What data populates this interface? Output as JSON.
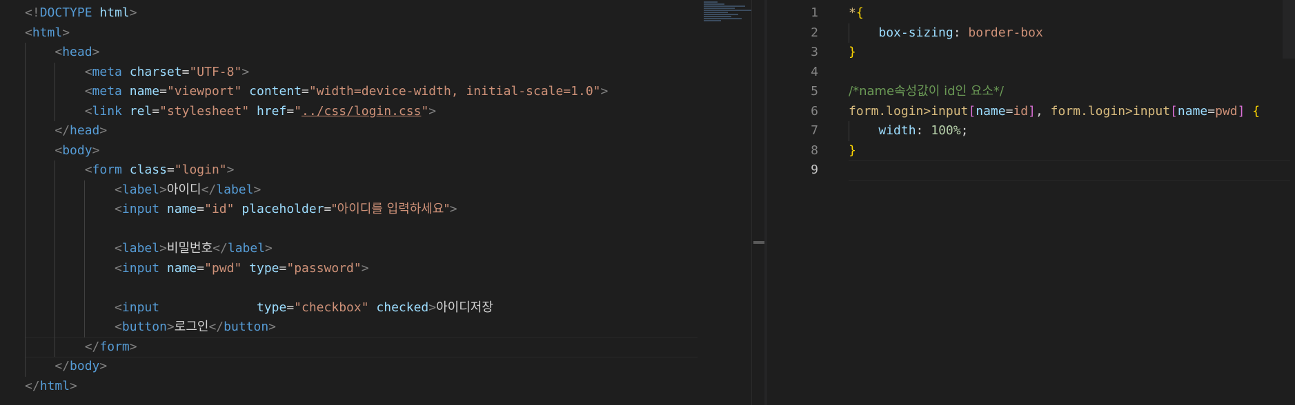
{
  "left_editor": {
    "lines": [
      [
        {
          "c": "t-br",
          "t": "<!"
        },
        {
          "c": "t-dt",
          "t": "DOCTYPE"
        },
        {
          "c": "t-txt",
          "t": " "
        },
        {
          "c": "t-attr",
          "t": "html"
        },
        {
          "c": "t-br",
          "t": ">"
        }
      ],
      [
        {
          "c": "t-br",
          "t": "<"
        },
        {
          "c": "t-tag",
          "t": "html"
        },
        {
          "c": "t-br",
          "t": ">"
        }
      ],
      [
        {
          "c": "t-txt",
          "t": "    "
        },
        {
          "c": "t-br",
          "t": "<"
        },
        {
          "c": "t-tag",
          "t": "head"
        },
        {
          "c": "t-br",
          "t": ">"
        }
      ],
      [
        {
          "c": "t-txt",
          "t": "        "
        },
        {
          "c": "t-br",
          "t": "<"
        },
        {
          "c": "t-tag",
          "t": "meta"
        },
        {
          "c": "t-txt",
          "t": " "
        },
        {
          "c": "t-attr",
          "t": "charset"
        },
        {
          "c": "t-txt",
          "t": "="
        },
        {
          "c": "t-str",
          "t": "\"UTF-8\""
        },
        {
          "c": "t-br",
          "t": ">"
        }
      ],
      [
        {
          "c": "t-txt",
          "t": "        "
        },
        {
          "c": "t-br",
          "t": "<"
        },
        {
          "c": "t-tag",
          "t": "meta"
        },
        {
          "c": "t-txt",
          "t": " "
        },
        {
          "c": "t-attr",
          "t": "name"
        },
        {
          "c": "t-txt",
          "t": "="
        },
        {
          "c": "t-str",
          "t": "\"viewport\""
        },
        {
          "c": "t-txt",
          "t": " "
        },
        {
          "c": "t-attr",
          "t": "content"
        },
        {
          "c": "t-txt",
          "t": "="
        },
        {
          "c": "t-str",
          "t": "\"width=device-width, initial-scale=1.0\""
        },
        {
          "c": "t-br",
          "t": ">"
        }
      ],
      [
        {
          "c": "t-txt",
          "t": "        "
        },
        {
          "c": "t-br",
          "t": "<"
        },
        {
          "c": "t-tag",
          "t": "link"
        },
        {
          "c": "t-txt",
          "t": " "
        },
        {
          "c": "t-attr",
          "t": "rel"
        },
        {
          "c": "t-txt",
          "t": "="
        },
        {
          "c": "t-str",
          "t": "\"stylesheet\""
        },
        {
          "c": "t-txt",
          "t": " "
        },
        {
          "c": "t-attr",
          "t": "href"
        },
        {
          "c": "t-txt",
          "t": "="
        },
        {
          "c": "t-str",
          "t": "\""
        },
        {
          "c": "t-str link",
          "t": "../css/login.css"
        },
        {
          "c": "t-str",
          "t": "\""
        },
        {
          "c": "t-br",
          "t": ">"
        }
      ],
      [
        {
          "c": "t-txt",
          "t": "    "
        },
        {
          "c": "t-br",
          "t": "</"
        },
        {
          "c": "t-tag",
          "t": "head"
        },
        {
          "c": "t-br",
          "t": ">"
        }
      ],
      [
        {
          "c": "t-txt",
          "t": "    "
        },
        {
          "c": "t-br",
          "t": "<"
        },
        {
          "c": "t-tag",
          "t": "body"
        },
        {
          "c": "t-br",
          "t": ">"
        }
      ],
      [
        {
          "c": "t-txt",
          "t": "        "
        },
        {
          "c": "t-br",
          "t": "<"
        },
        {
          "c": "t-tag",
          "t": "form"
        },
        {
          "c": "t-txt",
          "t": " "
        },
        {
          "c": "t-attr",
          "t": "class"
        },
        {
          "c": "t-txt",
          "t": "="
        },
        {
          "c": "t-str",
          "t": "\"login\""
        },
        {
          "c": "t-br",
          "t": ">"
        }
      ],
      [
        {
          "c": "t-txt",
          "t": "            "
        },
        {
          "c": "t-br",
          "t": "<"
        },
        {
          "c": "t-tag",
          "t": "label"
        },
        {
          "c": "t-br",
          "t": ">"
        },
        {
          "c": "t-txt ko",
          "t": "아이디"
        },
        {
          "c": "t-br",
          "t": "</"
        },
        {
          "c": "t-tag",
          "t": "label"
        },
        {
          "c": "t-br",
          "t": ">"
        }
      ],
      [
        {
          "c": "t-txt",
          "t": "            "
        },
        {
          "c": "t-br",
          "t": "<"
        },
        {
          "c": "t-tag",
          "t": "input"
        },
        {
          "c": "t-txt",
          "t": " "
        },
        {
          "c": "t-attr",
          "t": "name"
        },
        {
          "c": "t-txt",
          "t": "="
        },
        {
          "c": "t-str",
          "t": "\"id\""
        },
        {
          "c": "t-txt",
          "t": " "
        },
        {
          "c": "t-attr",
          "t": "placeholder"
        },
        {
          "c": "t-txt",
          "t": "="
        },
        {
          "c": "t-str ko",
          "t": "\"아이디를 입력하세요\""
        },
        {
          "c": "t-br",
          "t": ">"
        }
      ],
      [],
      [
        {
          "c": "t-txt",
          "t": "            "
        },
        {
          "c": "t-br",
          "t": "<"
        },
        {
          "c": "t-tag",
          "t": "label"
        },
        {
          "c": "t-br",
          "t": ">"
        },
        {
          "c": "t-txt ko",
          "t": "비밀번호"
        },
        {
          "c": "t-br",
          "t": "</"
        },
        {
          "c": "t-tag",
          "t": "label"
        },
        {
          "c": "t-br",
          "t": ">"
        }
      ],
      [
        {
          "c": "t-txt",
          "t": "            "
        },
        {
          "c": "t-br",
          "t": "<"
        },
        {
          "c": "t-tag",
          "t": "input"
        },
        {
          "c": "t-txt",
          "t": " "
        },
        {
          "c": "t-attr",
          "t": "name"
        },
        {
          "c": "t-txt",
          "t": "="
        },
        {
          "c": "t-str",
          "t": "\"pwd\""
        },
        {
          "c": "t-txt",
          "t": " "
        },
        {
          "c": "t-attr",
          "t": "type"
        },
        {
          "c": "t-txt",
          "t": "="
        },
        {
          "c": "t-str",
          "t": "\"password\""
        },
        {
          "c": "t-br",
          "t": ">"
        }
      ],
      [],
      [
        {
          "c": "t-txt",
          "t": "            "
        },
        {
          "c": "t-br",
          "t": "<"
        },
        {
          "c": "t-tag",
          "t": "input"
        },
        {
          "c": "t-txt",
          "t": "             "
        },
        {
          "c": "t-attr",
          "t": "type"
        },
        {
          "c": "t-txt",
          "t": "="
        },
        {
          "c": "t-str",
          "t": "\"checkbox\""
        },
        {
          "c": "t-txt",
          "t": " "
        },
        {
          "c": "t-attr",
          "t": "checked"
        },
        {
          "c": "t-br",
          "t": ">"
        },
        {
          "c": "t-txt ko",
          "t": "아이디저장"
        }
      ],
      [
        {
          "c": "t-txt",
          "t": "            "
        },
        {
          "c": "t-br",
          "t": "<"
        },
        {
          "c": "t-tag",
          "t": "button"
        },
        {
          "c": "t-br",
          "t": ">"
        },
        {
          "c": "t-txt ko",
          "t": "로그인"
        },
        {
          "c": "t-br",
          "t": "</"
        },
        {
          "c": "t-tag",
          "t": "button"
        },
        {
          "c": "t-br",
          "t": ">"
        }
      ],
      [
        {
          "c": "t-txt",
          "t": "        "
        },
        {
          "c": "t-br",
          "t": "</"
        },
        {
          "c": "t-tag",
          "t": "form"
        },
        {
          "c": "t-br",
          "t": ">"
        }
      ],
      [
        {
          "c": "t-txt",
          "t": "    "
        },
        {
          "c": "t-br",
          "t": "</"
        },
        {
          "c": "t-tag",
          "t": "body"
        },
        {
          "c": "t-br",
          "t": ">"
        }
      ],
      [
        {
          "c": "t-br",
          "t": "</"
        },
        {
          "c": "t-tag",
          "t": "html"
        },
        {
          "c": "t-br",
          "t": ">"
        }
      ]
    ]
  },
  "right_editor": {
    "line_numbers": [
      "1",
      "2",
      "3",
      "4",
      "5",
      "6",
      "7",
      "8",
      "9"
    ],
    "active_line": "9",
    "lines": [
      [
        {
          "c": "t-sel",
          "t": "*"
        },
        {
          "c": "t-br2",
          "t": "{"
        }
      ],
      [
        {
          "c": "t-txt",
          "t": "    "
        },
        {
          "c": "t-attr",
          "t": "box-sizing"
        },
        {
          "c": "t-txt",
          "t": ": "
        },
        {
          "c": "t-str",
          "t": "border-box"
        }
      ],
      [
        {
          "c": "t-br2",
          "t": "}"
        }
      ],
      [],
      [
        {
          "c": "t-com ko",
          "t": "/*name속성값이 id인 요소*/"
        }
      ],
      [
        {
          "c": "t-sel",
          "t": "form.login>input"
        },
        {
          "c": "t-br3",
          "t": "["
        },
        {
          "c": "t-attr",
          "t": "name"
        },
        {
          "c": "t-txt",
          "t": "="
        },
        {
          "c": "t-str",
          "t": "id"
        },
        {
          "c": "t-br3",
          "t": "]"
        },
        {
          "c": "t-txt",
          "t": ", "
        },
        {
          "c": "t-sel",
          "t": "form.login>input"
        },
        {
          "c": "t-br3",
          "t": "["
        },
        {
          "c": "t-attr",
          "t": "name"
        },
        {
          "c": "t-txt",
          "t": "="
        },
        {
          "c": "t-str",
          "t": "pwd"
        },
        {
          "c": "t-br3",
          "t": "]"
        },
        {
          "c": "t-txt",
          "t": " "
        },
        {
          "c": "t-br2",
          "t": "{"
        }
      ],
      [
        {
          "c": "t-txt",
          "t": "    "
        },
        {
          "c": "t-attr",
          "t": "width"
        },
        {
          "c": "t-txt",
          "t": ": "
        },
        {
          "c": "t-num",
          "t": "100%"
        },
        {
          "c": "t-txt",
          "t": ";"
        }
      ],
      [
        {
          "c": "t-br2",
          "t": "}"
        }
      ],
      []
    ]
  },
  "colors": {
    "background": "#1e1e1e",
    "tag": "#569cd6",
    "attribute": "#9cdcfe",
    "string": "#ce9178",
    "comment": "#6a9955",
    "selector": "#d7ba7d",
    "bracket_gold": "#ffd700",
    "bracket_purple": "#da70d6"
  }
}
